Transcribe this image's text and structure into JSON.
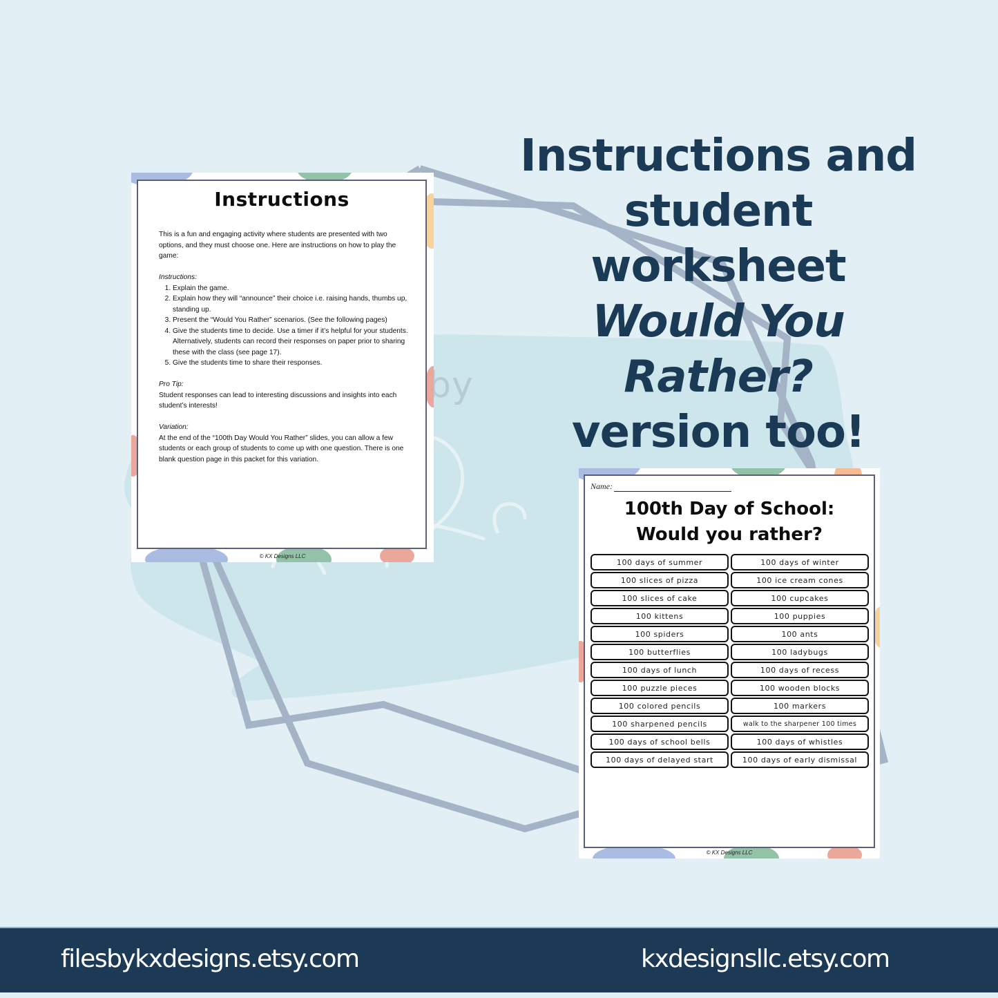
{
  "headline": {
    "line1": "Instructions and",
    "line2": "student worksheet",
    "line3": "Would You Rather?",
    "line4": "version too!"
  },
  "watermark": {
    "by_text": "by",
    "script_text": "KX De"
  },
  "instructions_page": {
    "title": "Instructions",
    "intro": "This is a fun and engaging activity where students are presented with two options, and they must choose one. Here are instructions on how to play the game:",
    "steps_heading": "Instructions:",
    "steps": [
      "Explain the game.",
      "Explain how they will “announce” their choice i.e. raising hands, thumbs up, standing up.",
      "Present the “Would You Rather” scenarios. (See the following pages)",
      "Give the students time to decide. Use a timer if it’s helpful for your students. Alternatively, students can record their responses on paper prior to sharing these with the class (see page 17).",
      "Give the students time to share their responses."
    ],
    "pro_tip_heading": "Pro Tip:",
    "pro_tip": "Student responses can lead to interesting discussions and insights into each student’s interests!",
    "variation_heading": "Variation:",
    "variation": "At the end of the “100th Day Would You Rather” slides, you can allow a few students or each group of students to come up with one question. There is one blank question page in this packet for this variation.",
    "copyright": "© KX Designs LLC"
  },
  "worksheet_page": {
    "name_label": "Name:",
    "title_line1": "100th Day of School:",
    "title_line2": "Would you rather?",
    "pairs": [
      [
        "100 days of summer",
        "100 days of winter"
      ],
      [
        "100 slices of pizza",
        "100 ice cream cones"
      ],
      [
        "100 slices of cake",
        "100 cupcakes"
      ],
      [
        "100 kittens",
        "100 puppies"
      ],
      [
        "100 spiders",
        "100 ants"
      ],
      [
        "100 butterflies",
        "100 ladybugs"
      ],
      [
        "100 days of lunch",
        "100 days of recess"
      ],
      [
        "100 puzzle pieces",
        "100 wooden blocks"
      ],
      [
        "100 colored pencils",
        "100 markers"
      ],
      [
        "100 sharpened pencils",
        "walk to the sharpener 100 times"
      ],
      [
        "100 days of school bells",
        "100 days of whistles"
      ],
      [
        "100 days of delayed start",
        "100 days of early dismissal"
      ]
    ],
    "copyright": "© KX Designs LLC"
  },
  "footer": {
    "left_link": "filesbykxdesigns.etsy.com",
    "right_link": "kxdesignsllc.etsy.com"
  },
  "colors": {
    "background": "#e2f0f5",
    "blob": "#cce6ec",
    "frame_lines": "#a5b3c6",
    "headline": "#1b3a56",
    "footer_bg": "#1c3a55"
  }
}
